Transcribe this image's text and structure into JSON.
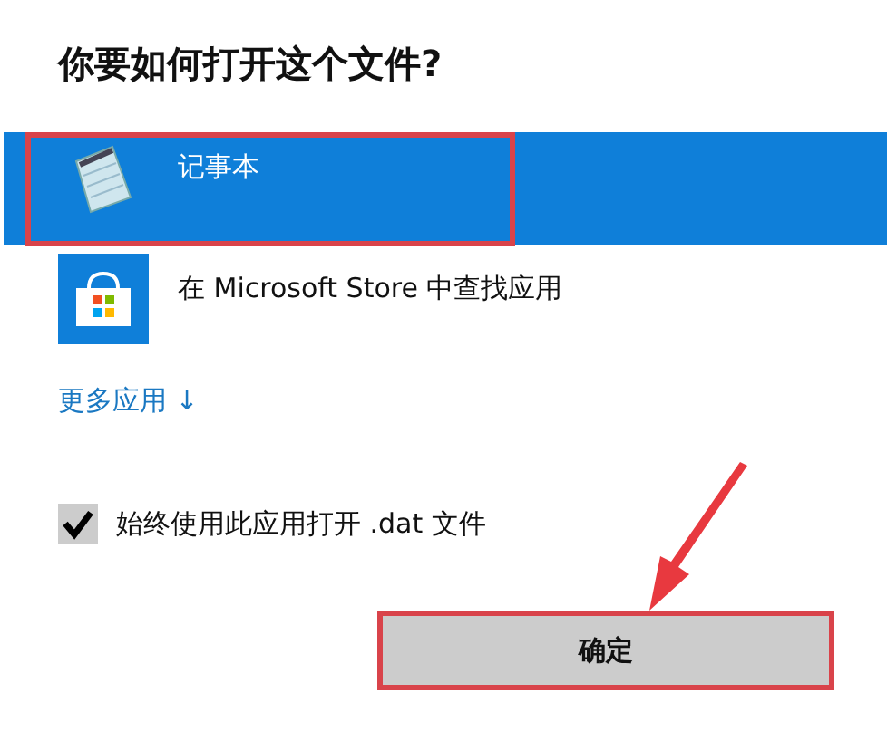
{
  "title": "你要如何打开这个文件?",
  "apps": [
    {
      "kind": "notepad",
      "name": "记事本",
      "selected": true
    },
    {
      "kind": "store",
      "name": "在 Microsoft Store 中查找应用",
      "selected": false
    }
  ],
  "more_link": "更多应用 ↓",
  "always_use": {
    "label": "始终使用此应用打开 .dat 文件",
    "checked": true
  },
  "ok_button": "确定"
}
